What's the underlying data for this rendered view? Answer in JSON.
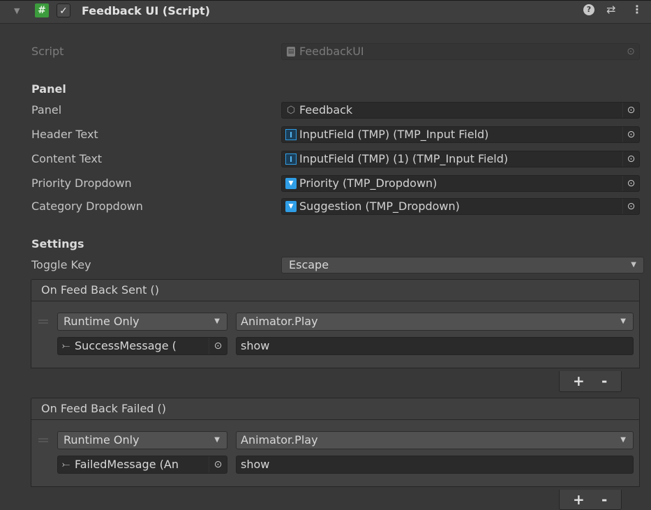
{
  "component": {
    "fold_icon": "triangle-down-icon",
    "script_icon_glyph": "#",
    "enabled_check_glyph": "✓",
    "title": "Feedback UI (Script)",
    "help_glyph": "?",
    "preset_glyph": "⇄",
    "menu_glyph": "⋮"
  },
  "script_row": {
    "label": "Script",
    "value": "FeedbackUI"
  },
  "panel_section": {
    "header": "Panel",
    "fields": [
      {
        "label": "Panel",
        "value": "Feedback",
        "icon": "gameobject-icon"
      },
      {
        "label": "Header Text",
        "value": "InputField (TMP) (TMP_Input Field)",
        "icon": "tmp-inputfield-icon"
      },
      {
        "label": "Content Text",
        "value": "InputField (TMP) (1) (TMP_Input Field)",
        "icon": "tmp-inputfield-icon"
      },
      {
        "label": "Priority Dropdown",
        "value": "Priority (TMP_Dropdown)",
        "icon": "tmp-dropdown-icon"
      },
      {
        "label": "Category Dropdown",
        "value": "Suggestion (TMP_Dropdown)",
        "icon": "tmp-dropdown-icon"
      }
    ]
  },
  "settings_section": {
    "header": "Settings",
    "toggle_key": {
      "label": "Toggle Key",
      "value": "Escape"
    }
  },
  "events": [
    {
      "header": "On Feed Back Sent ()",
      "runtime": "Runtime Only",
      "function": "Animator.Play",
      "target": "SuccessMessage (",
      "argument": "show"
    },
    {
      "header": "On Feed Back Failed ()",
      "runtime": "Runtime Only",
      "function": "Animator.Play",
      "target": "FailedMessage (An",
      "argument": "show"
    }
  ],
  "list_buttons": {
    "add": "+",
    "remove": "-"
  }
}
